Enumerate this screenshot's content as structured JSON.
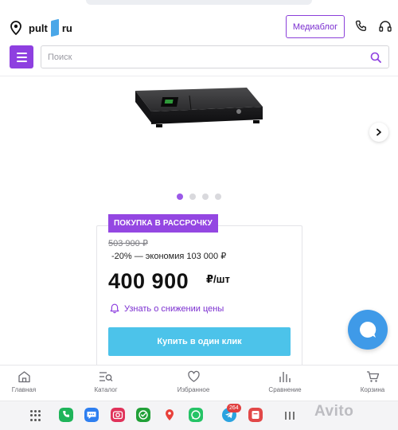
{
  "header": {
    "logo_part1": "pult",
    "logo_part2": "ru",
    "blog_button": "Медиаблог",
    "icons": [
      "location-pin-icon",
      "phone-icon",
      "headset-icon"
    ]
  },
  "search": {
    "placeholder": "Поиск",
    "icons": [
      "menu-icon",
      "search-icon"
    ]
  },
  "gallery": {
    "slides_total": 4,
    "active_index": 0,
    "icons": [
      "chevron-right-icon"
    ]
  },
  "offer": {
    "badge": "ПОКУПКА В РАССРОЧКУ",
    "old_price": "503 900 ₽",
    "discount": "-20% — экономия 103 000 ₽",
    "price": "400 900",
    "unit": "₽/шт",
    "notify": "Узнать о снижении цены",
    "buy_button": "Купить в один клик"
  },
  "bottom_nav": {
    "items": [
      {
        "label": "Главная",
        "icon": "home-icon"
      },
      {
        "label": "Каталог",
        "icon": "catalog-icon"
      },
      {
        "label": "Избранное",
        "icon": "heart-icon"
      },
      {
        "label": "Сравнение",
        "icon": "compare-icon"
      },
      {
        "label": "Корзина",
        "icon": "cart-icon"
      }
    ]
  },
  "system_bar": {
    "telegram_badge": "264",
    "watermark": "Avito"
  },
  "colors": {
    "accent": "#8e3fe0",
    "buy": "#4cc3ea",
    "chat": "#3f9ae8"
  }
}
